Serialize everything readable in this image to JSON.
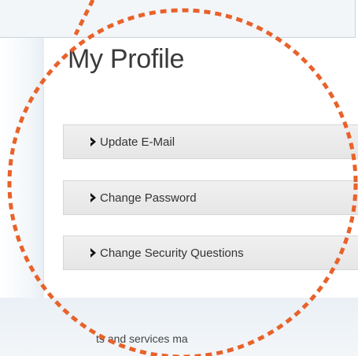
{
  "page": {
    "title": "My Profile"
  },
  "menu": {
    "items": [
      {
        "label": "Update E-Mail",
        "icon": "chevron-right-icon"
      },
      {
        "label": "Change Password",
        "icon": "chevron-right-icon"
      },
      {
        "label": "Change Security Questions",
        "icon": "chevron-right-icon"
      }
    ]
  },
  "footer": {
    "partial_text": "ts and services ma"
  },
  "colors": {
    "highlight_ring": "#e8622a",
    "menu_background": "#eaeaea",
    "title_text": "#3a3a3a"
  }
}
